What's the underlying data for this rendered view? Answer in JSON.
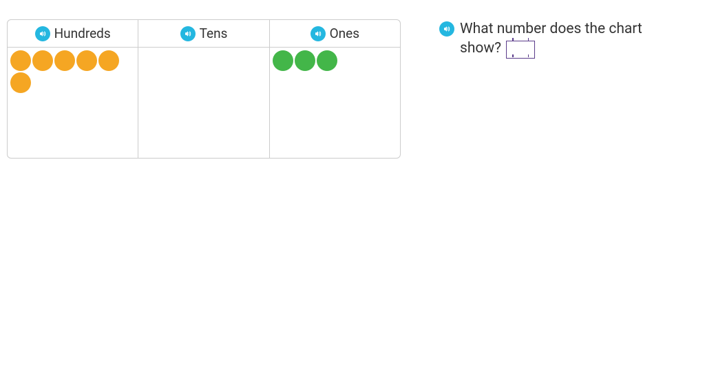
{
  "chart": {
    "columns": [
      {
        "label": "Hundreds",
        "count": 6,
        "color": "#f5a623"
      },
      {
        "label": "Tens",
        "count": 0,
        "color": "#7ed321"
      },
      {
        "label": "Ones",
        "count": 3,
        "color": "#43b649"
      }
    ]
  },
  "question": {
    "text": "What number does the chart show?",
    "answer_value": ""
  },
  "icons": {
    "speaker": "speaker"
  }
}
